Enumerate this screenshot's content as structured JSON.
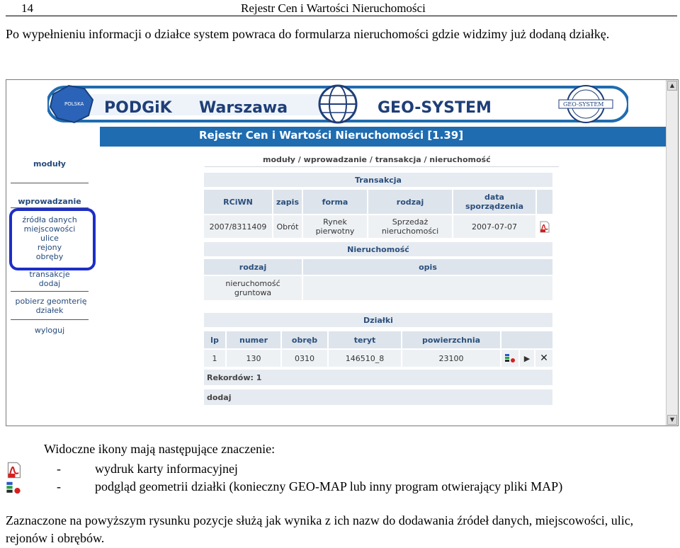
{
  "page_header": {
    "number": "14",
    "title": "Rejestr Cen i Wartości Nieruchomości"
  },
  "intro": "Po wypełnieniu informacji o działce system powraca do formularza nieruchomości gdzie widzimy już dodaną działkę.",
  "screenshot": {
    "banner": {
      "podgik": "PODGiK",
      "warszawa": "Warszawa",
      "geosystem": "GEO-SYSTEM",
      "seal": "GEO-SYSTEM",
      "map_label": "POLSKA"
    },
    "app_title": "Rejestr Cen i Wartości Nieruchomości [1.39]",
    "breadcrumb": "moduły / wprowadzanie / transakcja / nieruchomość",
    "nav": {
      "moduly": "moduły",
      "wprowadzanie": "wprowadzanie",
      "zrodla": "źródła danych",
      "miejscowosci": "miejscowości",
      "ulice": "ulice",
      "rejony": "rejony",
      "obreby": "obręby",
      "transakcje": "transakcje",
      "dodaj": "dodaj",
      "pobierz1": "pobierz geomterię",
      "pobierz2": "działek",
      "wyloguj": "wyloguj"
    },
    "transakcja": {
      "title": "Transakcja",
      "headers": [
        "RCiWN",
        "zapis",
        "forma",
        "rodzaj",
        "data sporządzenia"
      ],
      "row": [
        "2007/8311409",
        "Obrót",
        "Rynek pierwotny",
        "Sprzedaż nieruchomości",
        "2007-07-07"
      ]
    },
    "nieruchomosc": {
      "title": "Nieruchomość",
      "headers": [
        "rodzaj",
        "opis"
      ],
      "row": [
        "nieruchomość gruntowa",
        ""
      ]
    },
    "dzialki": {
      "title": "Działki",
      "headers": [
        "lp",
        "numer",
        "obręb",
        "teryt",
        "powierzchnia"
      ],
      "row": [
        "1",
        "130",
        "0310",
        "146510_8",
        "23100"
      ],
      "rekordow": "Rekordów: 1",
      "dodaj": "dodaj"
    }
  },
  "legend": {
    "heading": "Widoczne ikony mają następujące znaczenie:",
    "items": [
      {
        "dash": "-",
        "text": "wydruk karty informacyjnej",
        "icon": "pdf-icon"
      },
      {
        "dash": "-",
        "text": "podgląd geometrii działki (konieczny GEO-MAP lub inny program otwierający pliki MAP)",
        "icon": "geometry-icon"
      }
    ]
  },
  "outro": "Zaznaczone na powyższym rysunku pozycje służą jak wynika z ich nazw do dodawania źródeł danych, miejscowości, ulic, rejonów i obrębów.",
  "colors": {
    "banner_blue": "#1f6cb0",
    "header_cell": "#dde4ec",
    "highlight_box": "#1d2ec8"
  }
}
